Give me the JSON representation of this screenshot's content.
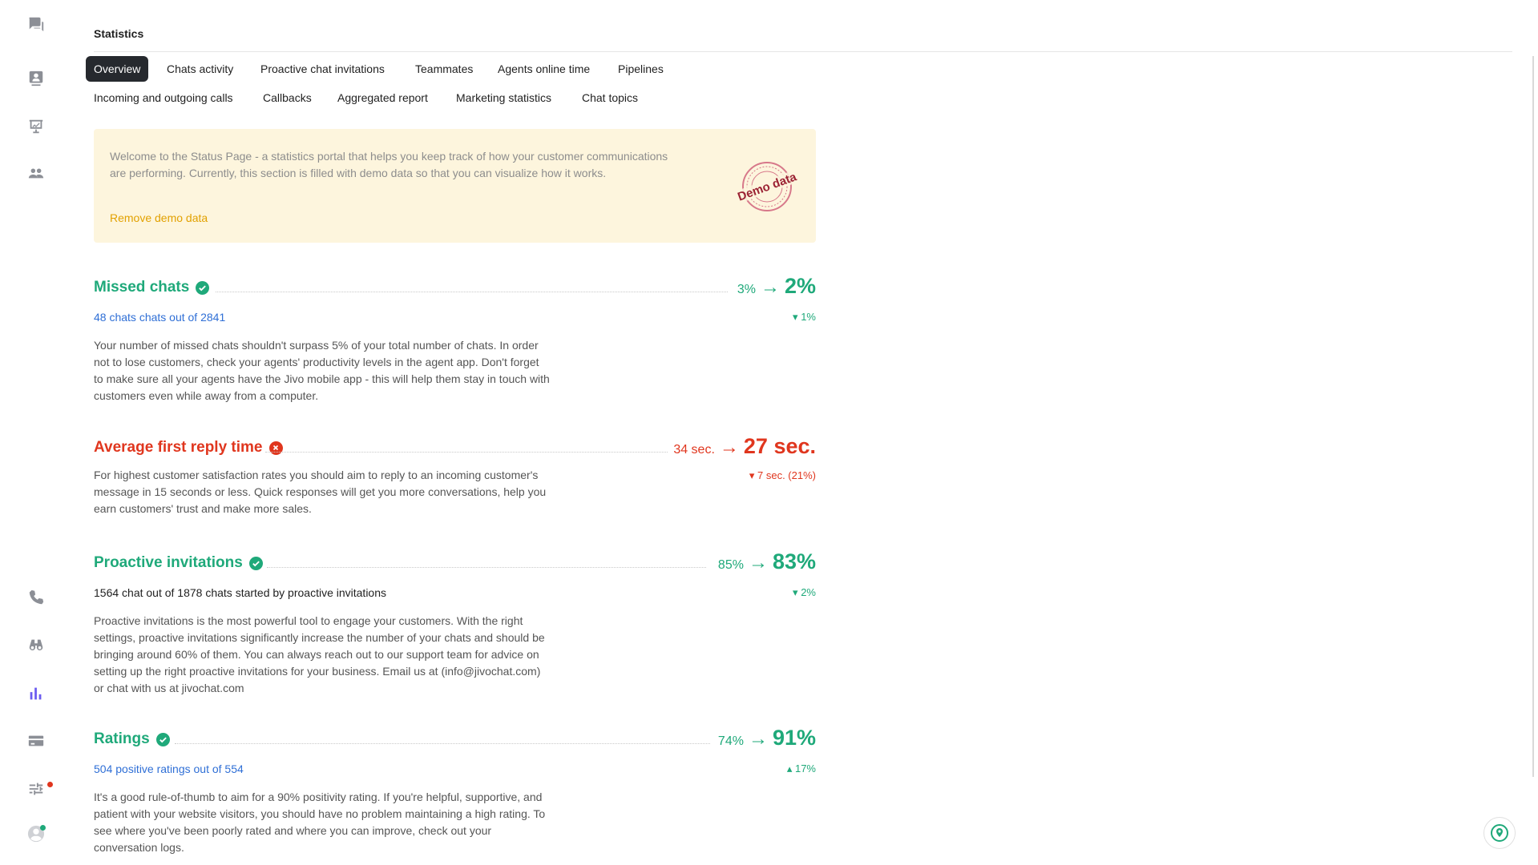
{
  "page": {
    "title": "Statistics"
  },
  "tabs_row1": [
    {
      "label": "Overview"
    },
    {
      "label": "Chats activity"
    },
    {
      "label": "Proactive chat invitations"
    },
    {
      "label": "Teammates"
    },
    {
      "label": "Agents online time"
    },
    {
      "label": "Pipelines"
    }
  ],
  "tabs_row2": [
    {
      "label": "Incoming and outgoing calls"
    },
    {
      "label": "Callbacks"
    },
    {
      "label": "Aggregated report"
    },
    {
      "label": "Marketing statistics"
    },
    {
      "label": "Chat topics"
    }
  ],
  "active_tab": "Overview",
  "banner": {
    "text": "Welcome to the Status Page - a statistics portal that helps you keep track of how your customer communications are performing. Currently, this section is filled with demo data so that you can visualize how it works.",
    "link": "Remove demo data",
    "stamp_text": "Demo data"
  },
  "metrics": [
    {
      "title": "Missed chats",
      "status": "ok",
      "old_value": "3%",
      "new_value": "2%",
      "subtitle": "48 chats chats out of 2841",
      "delta": "1%",
      "delta_direction": "down",
      "description": "Your number of missed chats shouldn't surpass 5% of your total number of chats. In order not to lose customers, check your agents' productivity levels in the agent app. Don't forget to make sure all your agents have the Jivo mobile app - this will help them stay in touch with customers even while away from a computer."
    },
    {
      "title": "Average first reply time",
      "status": "bad",
      "old_value": "34 sec.",
      "new_value": "27 sec.",
      "subtitle": "",
      "delta": "7 sec. (21%)",
      "delta_direction": "down",
      "description": "For highest customer satisfaction rates you should aim to reply to an incoming customer's message in 15 seconds or less. Quick responses will get you more conversations, help you earn customers' trust and make more sales."
    },
    {
      "title": "Proactive invitations",
      "status": "ok",
      "old_value": "85%",
      "new_value": "83%",
      "subtitle": "1564 chat out of 1878 chats started by proactive invitations",
      "delta": "2%",
      "delta_direction": "down",
      "description": "Proactive invitations is the most powerful tool to engage your customers. With the right settings, proactive invitations significantly increase the number of your chats and should be bringing around 60% of them. You can always reach out to our support team for advice on setting up the right proactive invitations for your business. Email us at (info@jivochat.com) or chat with us at jivochat.com"
    },
    {
      "title": "Ratings",
      "status": "ok",
      "old_value": "74%",
      "new_value": "91%",
      "subtitle": "504 positive ratings out of 554",
      "delta": "17%",
      "delta_direction": "up",
      "description": "It's a good rule-of-thumb to aim for a 90% positivity rating. If you're helpful, supportive, and patient with your website visitors, you should have no problem maintaining a high rating. To see where you've been poorly rated and where you can improve, check out your conversation logs."
    }
  ],
  "colors": {
    "green": "#1fa97a",
    "red": "#e0361e",
    "blue": "#2f6fd6",
    "accent": "#6b5cf0",
    "banner_bg": "#fdf5dd"
  },
  "sidebar_icons": [
    "chats-icon",
    "contacts-icon",
    "presentation-icon",
    "team-icon",
    "phone-icon",
    "binoculars-icon",
    "statistics-icon",
    "billing-icon",
    "settings-icon",
    "profile-icon"
  ]
}
